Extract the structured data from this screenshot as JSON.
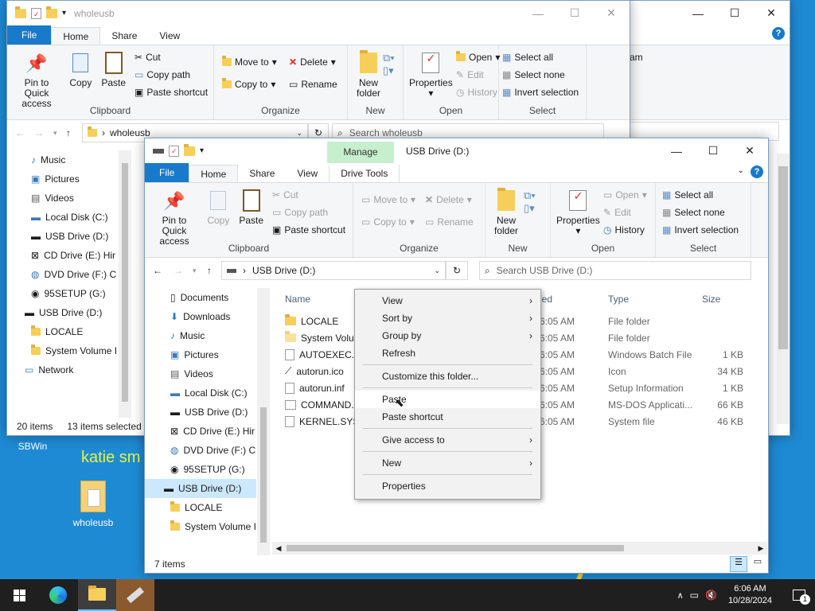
{
  "desktop": {
    "icons": [
      {
        "label": "SBWin"
      },
      {
        "label": "wholeusb"
      }
    ],
    "overlay_text": "katie sm"
  },
  "back_window": {
    "title": "wholeusb",
    "tabs": [
      "File",
      "Home",
      "Share",
      "View"
    ],
    "ribbon": {
      "clipboard": {
        "pin": "Pin to Quick access",
        "copy": "Copy",
        "paste": "Paste",
        "cut": "Cut",
        "copy_path": "Copy path",
        "paste_shortcut": "Paste shortcut",
        "label": "Clipboard"
      },
      "organize": {
        "move_to": "Move to",
        "copy_to": "Copy to",
        "delete": "Delete",
        "rename": "Rename",
        "label": "Organize"
      },
      "new": {
        "new_folder": "New folder",
        "label": "New"
      },
      "open": {
        "properties": "Properties",
        "open": "Open",
        "edit": "Edit",
        "history": "History",
        "label": "Open"
      },
      "select": {
        "select_all": "Select all",
        "select_none": "Select none",
        "invert": "Invert selection",
        "label": "Select"
      }
    },
    "address": {
      "path": "wholeusb",
      "search_placeholder": "Search wholeusb"
    },
    "nav": [
      "Music",
      "Pictures",
      "Videos",
      "Local Disk (C:)",
      "USB Drive (D:)",
      "CD Drive (E:) Hir",
      "DVD Drive (F:) C",
      "95SETUP (G:)",
      "USB Drive (D:)",
      "LOCALE",
      "System Volume I",
      "Network"
    ],
    "status": {
      "items": "20 items",
      "selected": "13 items selected"
    }
  },
  "back_window2": {
    "ribbon_text": "am"
  },
  "front_window": {
    "title": "USB Drive (D:)",
    "context_tab": {
      "manage": "Manage",
      "drive_tools": "Drive Tools"
    },
    "tabs": [
      "File",
      "Home",
      "Share",
      "View"
    ],
    "ribbon": {
      "clipboard": {
        "pin": "Pin to Quick access",
        "copy": "Copy",
        "paste": "Paste",
        "cut": "Cut",
        "copy_path": "Copy path",
        "paste_shortcut": "Paste shortcut",
        "label": "Clipboard"
      },
      "organize": {
        "move_to": "Move to",
        "copy_to": "Copy to",
        "delete": "Delete",
        "rename": "Rename",
        "label": "Organize"
      },
      "new": {
        "new_folder": "New folder",
        "label": "New"
      },
      "open": {
        "properties": "Properties",
        "open": "Open",
        "edit": "Edit",
        "history": "History",
        "label": "Open"
      },
      "select": {
        "select_all": "Select all",
        "select_none": "Select none",
        "invert": "Invert selection",
        "label": "Select"
      }
    },
    "address": {
      "path": "USB Drive (D:)",
      "search_placeholder": "Search USB Drive (D:)"
    },
    "nav": [
      "Documents",
      "Downloads",
      "Music",
      "Pictures",
      "Videos",
      "Local Disk (C:)",
      "USB Drive (D:)",
      "CD Drive (E:) Hir",
      "DVD Drive (F:) C",
      "95SETUP (G:)",
      "USB Drive (D:)",
      "LOCALE",
      "System Volume I"
    ],
    "columns": {
      "name": "Name",
      "date": "ied",
      "type": "Type",
      "size": "Size"
    },
    "files": [
      {
        "name": "LOCALE",
        "date": "6:05 AM",
        "type": "File folder",
        "size": ""
      },
      {
        "name": "System Volu",
        "date": "6:05 AM",
        "type": "File folder",
        "size": ""
      },
      {
        "name": "AUTOEXEC.B",
        "date": "6:05 AM",
        "type": "Windows Batch File",
        "size": "1 KB"
      },
      {
        "name": "autorun.ico",
        "date": "6:05 AM",
        "type": "Icon",
        "size": "34 KB"
      },
      {
        "name": "autorun.inf",
        "date": "6:05 AM",
        "type": "Setup Information",
        "size": "1 KB"
      },
      {
        "name": "COMMAND.",
        "date": "6:05 AM",
        "type": "MS-DOS Applicati...",
        "size": "66 KB"
      },
      {
        "name": "KERNEL.SYS",
        "date": "6:05 AM",
        "type": "System file",
        "size": "46 KB"
      }
    ],
    "status": {
      "items": "7 items"
    }
  },
  "context_menu": {
    "items": [
      {
        "label": "View",
        "submenu": true
      },
      {
        "label": "Sort by",
        "submenu": true
      },
      {
        "label": "Group by",
        "submenu": true
      },
      {
        "label": "Refresh",
        "submenu": false
      },
      {
        "label": "Customize this folder...",
        "submenu": false
      },
      {
        "label": "Paste",
        "submenu": false
      },
      {
        "label": "Paste shortcut",
        "submenu": false
      },
      {
        "label": "Give access to",
        "submenu": true
      },
      {
        "label": "New",
        "submenu": true
      },
      {
        "label": "Properties",
        "submenu": false
      }
    ]
  },
  "taskbar": {
    "time": "6:06 AM",
    "date": "10/28/2024",
    "notification_count": "1"
  },
  "colors": {
    "accent": "#1979ca",
    "desktop": "#1e8ad4",
    "manage_tab": "#c6efce"
  }
}
